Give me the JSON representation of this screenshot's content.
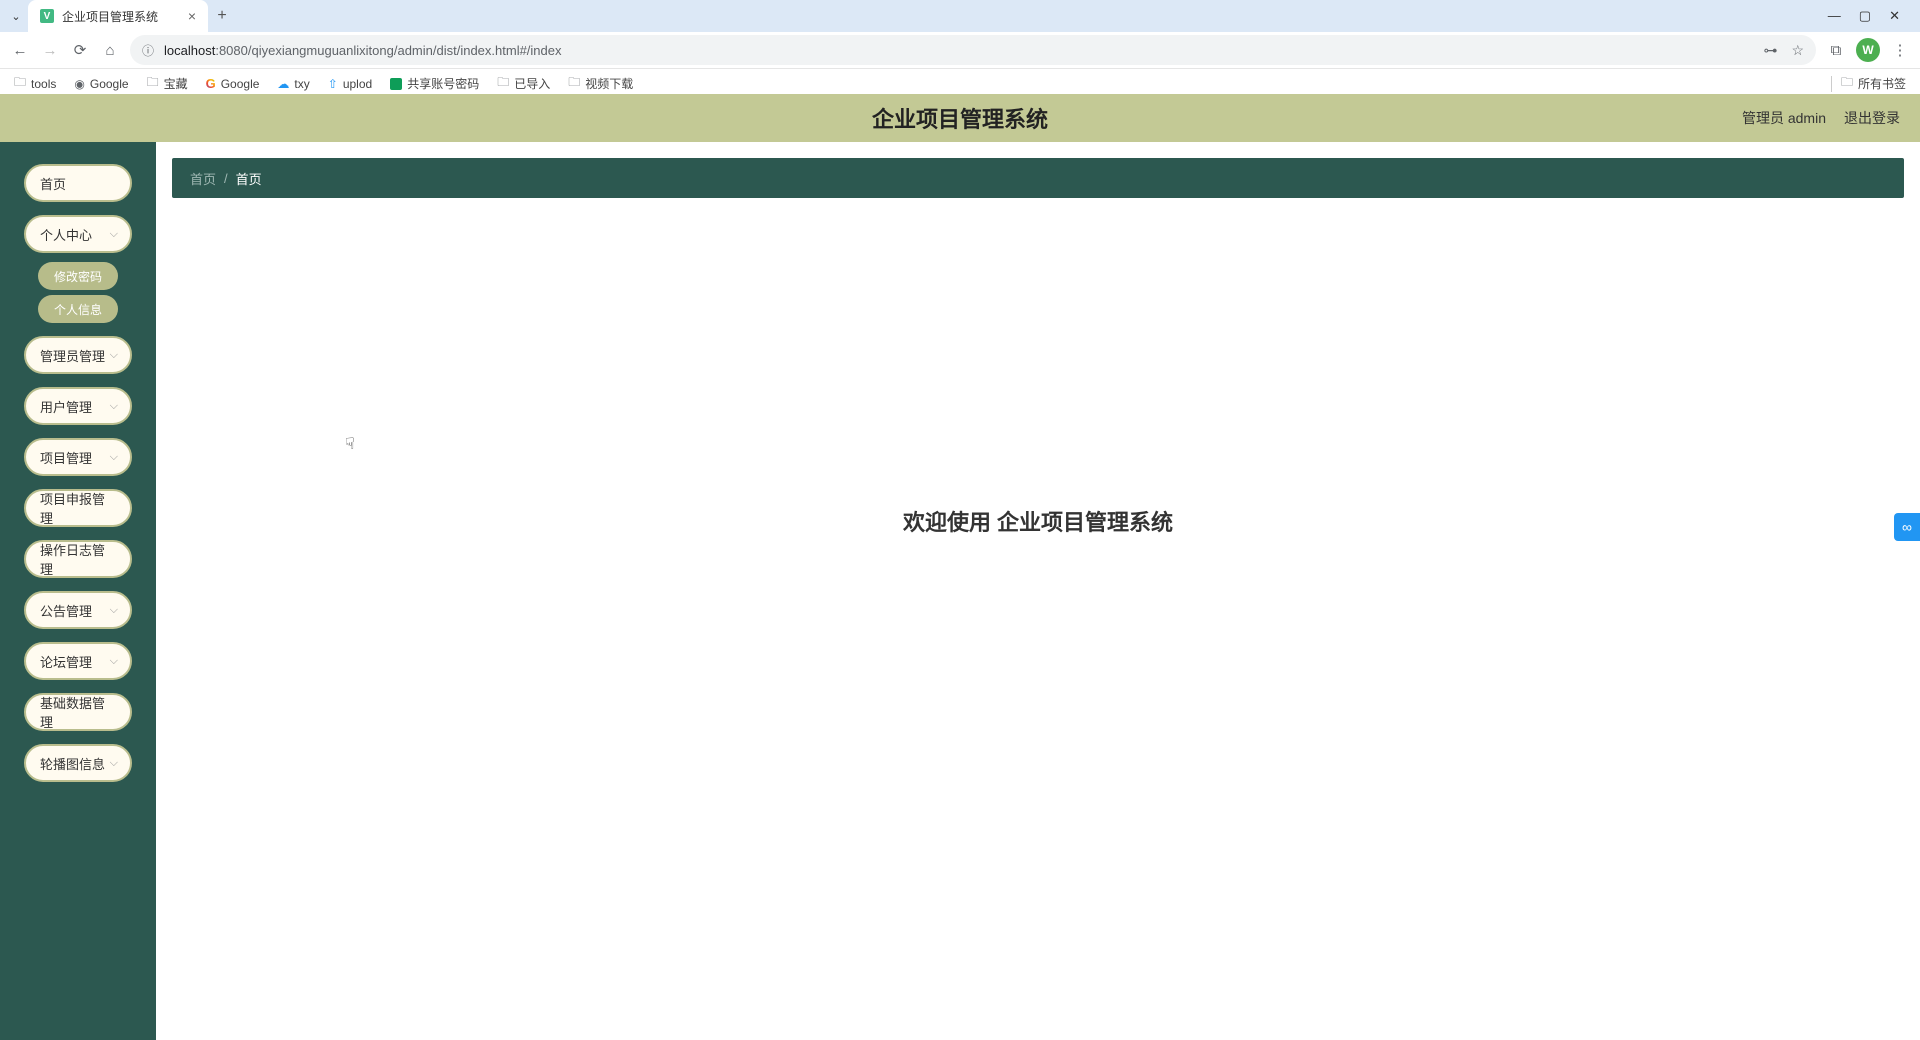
{
  "browser": {
    "tab_title": "企业项目管理系统",
    "url_host": "localhost",
    "url_port": ":8080",
    "url_path": "/qiyexiangmuguanlixitong/admin/dist/index.html#/index",
    "bookmarks": [
      {
        "label": "tools",
        "icon": "folder"
      },
      {
        "label": "Google",
        "icon": "google"
      },
      {
        "label": "宝藏",
        "icon": "folder"
      },
      {
        "label": "Google",
        "icon": "google-g"
      },
      {
        "label": "txy",
        "icon": "blue"
      },
      {
        "label": "uplod",
        "icon": "blue"
      },
      {
        "label": "共享账号密码",
        "icon": "green"
      },
      {
        "label": "已导入",
        "icon": "folder"
      },
      {
        "label": "视频下载",
        "icon": "folder"
      }
    ],
    "all_bookmarks": "所有书签",
    "profile_letter": "W"
  },
  "header": {
    "app_title": "企业项目管理系统",
    "user_info": "管理员 admin",
    "logout": "退出登录"
  },
  "sidebar": {
    "items": [
      {
        "label": "首页",
        "chevron": false
      },
      {
        "label": "个人中心",
        "chevron": true
      },
      {
        "label": "管理员管理",
        "chevron": true
      },
      {
        "label": "用户管理",
        "chevron": true
      },
      {
        "label": "项目管理",
        "chevron": true
      },
      {
        "label": "项目申报管理",
        "chevron": false
      },
      {
        "label": "操作日志管理",
        "chevron": false
      },
      {
        "label": "公告管理",
        "chevron": true
      },
      {
        "label": "论坛管理",
        "chevron": true
      },
      {
        "label": "基础数据管理",
        "chevron": false
      },
      {
        "label": "轮播图信息",
        "chevron": true
      }
    ],
    "submenu": [
      {
        "label": "修改密码"
      },
      {
        "label": "个人信息"
      }
    ]
  },
  "breadcrumb": {
    "home": "首页",
    "current": "首页"
  },
  "main": {
    "welcome": "欢迎使用 企业项目管理系统"
  }
}
